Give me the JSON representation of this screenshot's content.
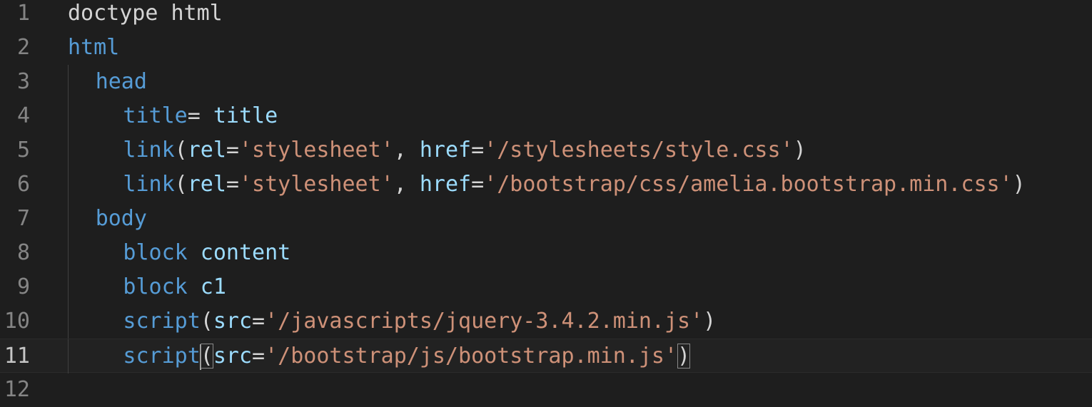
{
  "editor": {
    "language": "pug",
    "colors": {
      "background": "#1e1e1e",
      "line_number": "#858585",
      "plain_text": "#d4d4d4",
      "tag": "#569cd6",
      "attribute": "#9cdcfe",
      "string": "#ce9178"
    },
    "current_line": 11,
    "lines": [
      {
        "number": "1",
        "indent": 0,
        "tokens": [
          {
            "t": "doctype html",
            "k": "plain"
          }
        ]
      },
      {
        "number": "2",
        "indent": 0,
        "tokens": [
          {
            "t": "html",
            "k": "tag"
          }
        ]
      },
      {
        "number": "3",
        "indent": 1,
        "tokens": [
          {
            "t": "head",
            "k": "tag"
          }
        ]
      },
      {
        "number": "4",
        "indent": 2,
        "tokens": [
          {
            "t": "title",
            "k": "tag"
          },
          {
            "t": "= ",
            "k": "plain"
          },
          {
            "t": "title",
            "k": "attribute"
          }
        ]
      },
      {
        "number": "5",
        "indent": 2,
        "tokens": [
          {
            "t": "link",
            "k": "tag"
          },
          {
            "t": "(",
            "k": "plain"
          },
          {
            "t": "rel",
            "k": "attribute"
          },
          {
            "t": "=",
            "k": "plain"
          },
          {
            "t": "'stylesheet'",
            "k": "string"
          },
          {
            "t": ", ",
            "k": "plain"
          },
          {
            "t": "href",
            "k": "attribute"
          },
          {
            "t": "=",
            "k": "plain"
          },
          {
            "t": "'/stylesheets/style.css'",
            "k": "string"
          },
          {
            "t": ")",
            "k": "plain"
          }
        ]
      },
      {
        "number": "6",
        "indent": 2,
        "tokens": [
          {
            "t": "link",
            "k": "tag"
          },
          {
            "t": "(",
            "k": "plain"
          },
          {
            "t": "rel",
            "k": "attribute"
          },
          {
            "t": "=",
            "k": "plain"
          },
          {
            "t": "'stylesheet'",
            "k": "string"
          },
          {
            "t": ", ",
            "k": "plain"
          },
          {
            "t": "href",
            "k": "attribute"
          },
          {
            "t": "=",
            "k": "plain"
          },
          {
            "t": "'/bootstrap/css/amelia.bootstrap.min.css'",
            "k": "string"
          },
          {
            "t": ")",
            "k": "plain"
          }
        ]
      },
      {
        "number": "7",
        "indent": 1,
        "tokens": [
          {
            "t": "body",
            "k": "tag"
          }
        ]
      },
      {
        "number": "8",
        "indent": 2,
        "tokens": [
          {
            "t": "block",
            "k": "tag"
          },
          {
            "t": " ",
            "k": "plain"
          },
          {
            "t": "content",
            "k": "attribute"
          }
        ]
      },
      {
        "number": "9",
        "indent": 2,
        "tokens": [
          {
            "t": "block",
            "k": "tag"
          },
          {
            "t": " ",
            "k": "plain"
          },
          {
            "t": "c1",
            "k": "attribute"
          }
        ]
      },
      {
        "number": "10",
        "indent": 2,
        "tokens": [
          {
            "t": "script",
            "k": "tag"
          },
          {
            "t": "(",
            "k": "plain"
          },
          {
            "t": "src",
            "k": "attribute"
          },
          {
            "t": "=",
            "k": "plain"
          },
          {
            "t": "'/javascripts/jquery-3.4.2.min.js'",
            "k": "string"
          },
          {
            "t": ")",
            "k": "plain"
          }
        ]
      },
      {
        "number": "11",
        "indent": 2,
        "tokens": [
          {
            "t": "script",
            "k": "tag"
          },
          {
            "t": "(",
            "k": "plain",
            "match": true,
            "cursor": true
          },
          {
            "t": "src",
            "k": "attribute"
          },
          {
            "t": "=",
            "k": "plain"
          },
          {
            "t": "'/bootstrap/js/bootstrap.min.js'",
            "k": "string"
          },
          {
            "t": ")",
            "k": "plain",
            "match": true
          }
        ]
      },
      {
        "number": "12",
        "indent": 0,
        "tokens": []
      }
    ]
  }
}
